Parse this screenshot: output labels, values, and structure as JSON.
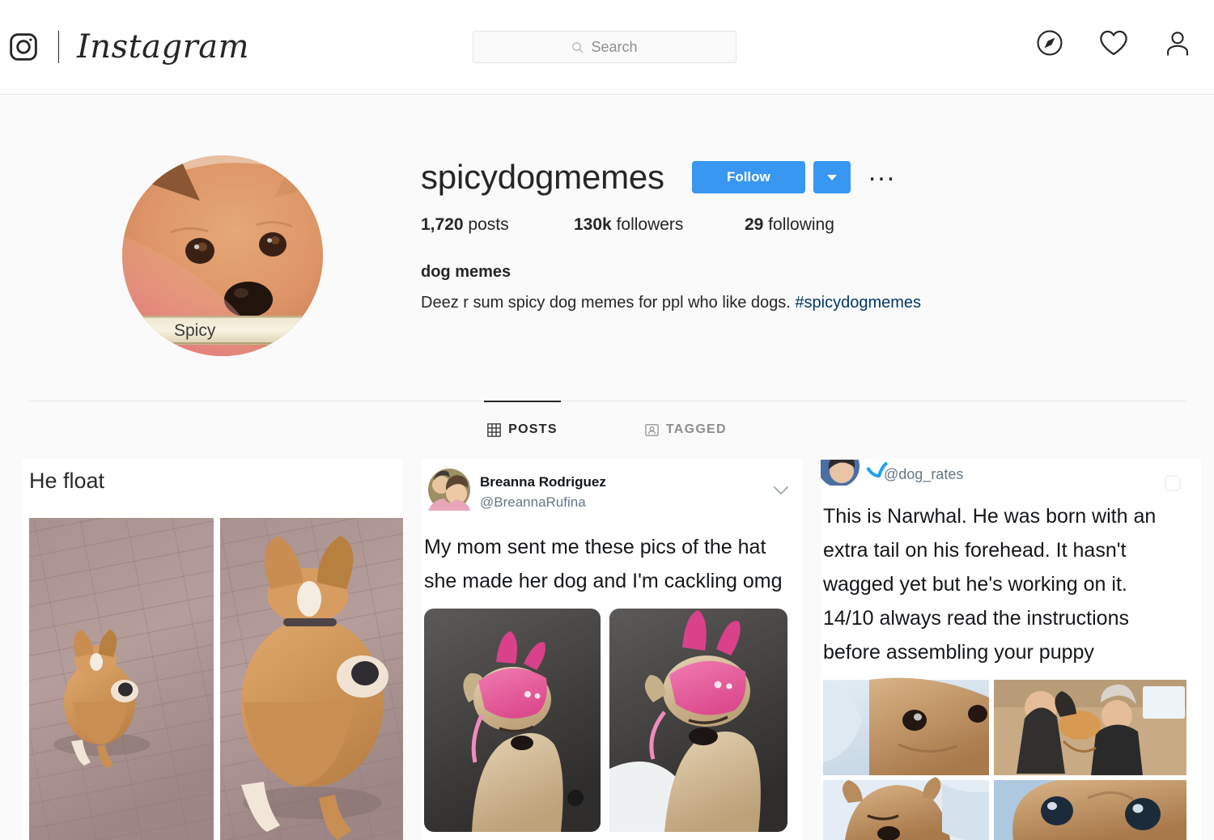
{
  "header": {
    "logo_icon": "instagram-camera-icon",
    "wordmark": "Instagram",
    "search": {
      "placeholder": "Search",
      "value": "",
      "icon": "search-icon"
    },
    "nav": [
      {
        "name": "explore-icon",
        "label": "Explore"
      },
      {
        "name": "activity-heart-icon",
        "label": "Activity"
      },
      {
        "name": "profile-person-icon",
        "label": "Profile"
      }
    ]
  },
  "profile": {
    "avatar": {
      "alt": "Shiba Inu dog with pink tint",
      "caption": "Spicy"
    },
    "username": "spicydogmemes",
    "follow_label": "Follow",
    "options_label": "...",
    "stats": [
      {
        "value": "1,720",
        "label": "posts"
      },
      {
        "value": "130k",
        "label": "followers"
      },
      {
        "value": "29",
        "label": "following"
      }
    ],
    "bio_title": "dog memes",
    "bio_text": "Deez r sum spicy dog memes for ppl who like dogs. ",
    "bio_hashtag": "#spicydogmemes"
  },
  "tabs": [
    {
      "label": "POSTS",
      "icon": "grid-icon",
      "active": true
    },
    {
      "label": "TAGGED",
      "icon": "tagged-person-icon",
      "active": false
    }
  ],
  "posts": [
    {
      "name": "post-corgi-float",
      "caption": "He float",
      "caption_clipped": true,
      "images": "two corgis running away on brick pavement",
      "multi": false
    },
    {
      "name": "post-breanna-hat-tweet",
      "tweet_author": "Breanna Rodriguez",
      "tweet_handle": "@BreannaRufina",
      "tweet_text": "My mom sent me these pics of the hat she made her dog and I'm cackling omg",
      "images": "two photos of small dog in pink crochet bunny hat",
      "multi": false
    },
    {
      "name": "post-dogrates-narwhal",
      "tweet_handle": "@dog_rates",
      "tweet_text": "This is Narwhal. He was born with an extra tail on his forehead. It hasn't wagged yet but he's working on it. 14/10 always read the instructions before assembling your puppy",
      "images": "four photos of a tan puppy",
      "multi": true
    }
  ],
  "colors": {
    "ig_blue": "#3897f0",
    "link_blue": "#00376b",
    "text": "#262626",
    "muted": "#8e8e8e",
    "page_bg": "#fafafa",
    "border": "#e6e6e6"
  }
}
